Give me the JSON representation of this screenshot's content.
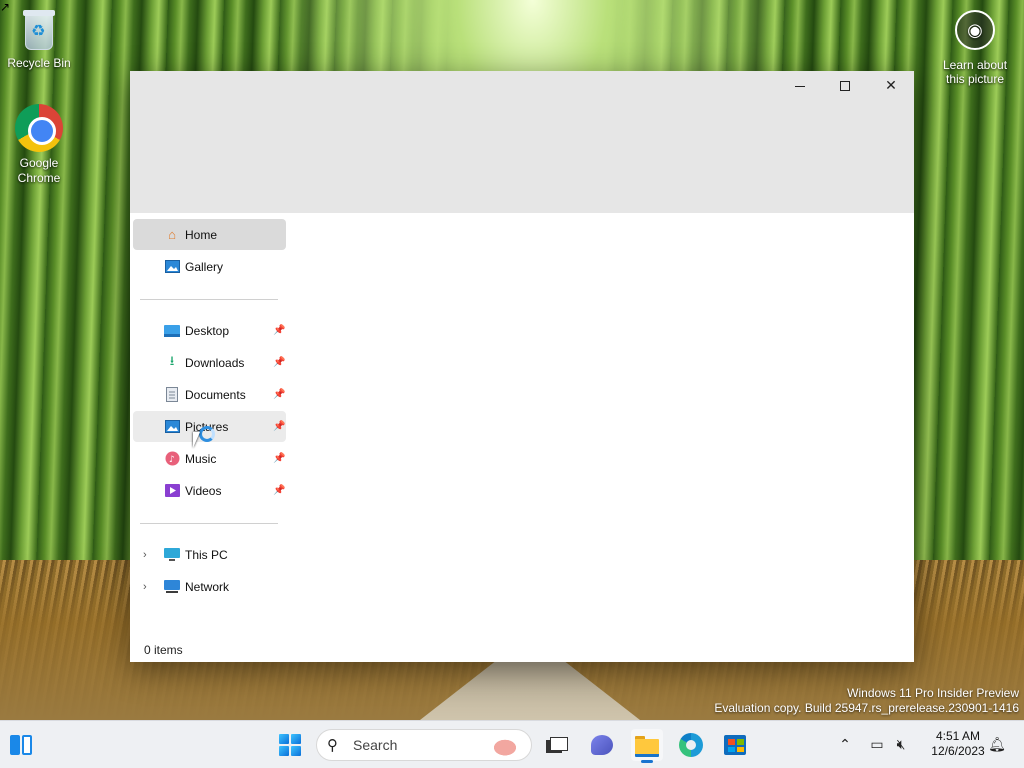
{
  "desktop": {
    "icons": [
      {
        "label": "Recycle Bin"
      },
      {
        "label": "Google Chrome"
      }
    ],
    "learn_about": "Learn about this picture"
  },
  "explorer": {
    "window_controls": {
      "minimize": "minimize-icon",
      "maximize": "maximize-icon",
      "close": "close-icon"
    },
    "nav": {
      "home": "Home",
      "gallery": "Gallery",
      "desktop": "Desktop",
      "downloads": "Downloads",
      "documents": "Documents",
      "pictures": "Pictures",
      "music": "Music",
      "videos": "Videos",
      "this_pc": "This PC",
      "network": "Network"
    },
    "status": "0 items"
  },
  "watermark": {
    "line1": "Windows 11 Pro Insider Preview",
    "line2": "Evaluation copy. Build 25947.rs_prerelease.230901-1416"
  },
  "taskbar": {
    "search_placeholder": "Search",
    "time": "4:51 AM",
    "date": "12/6/2023"
  }
}
